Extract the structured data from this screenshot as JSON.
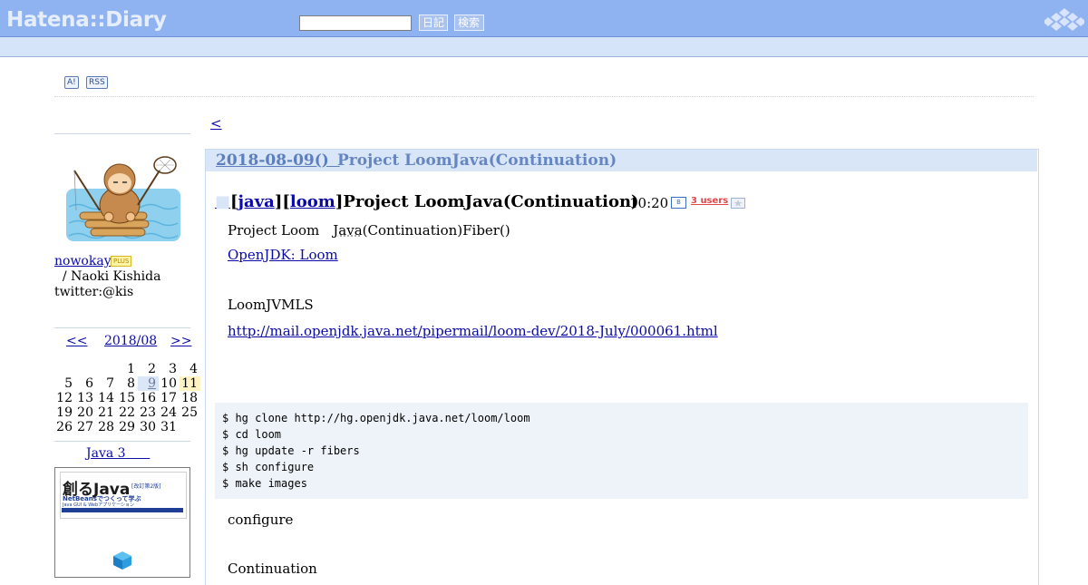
{
  "header": {
    "logo": "Hatena::Diary",
    "search": {
      "value": "",
      "placeholder": ""
    },
    "diary_button": "日記",
    "search_button": "検索"
  },
  "icons": {
    "a_badge": "A!",
    "rss_badge": "RSS"
  },
  "sidebar": {
    "user_link": "nowokay",
    "plus_badge": "PLUS",
    "user_name": "  / Naoki Kishida",
    "twitter": "twitter:@kis",
    "calendar": {
      "prev": "<<",
      "title": "2018/08",
      "next": ">>",
      "weeks": [
        [
          "",
          "",
          "",
          "1",
          "2",
          "3",
          "4"
        ],
        [
          "5",
          "6",
          "7",
          "8",
          "9",
          "10",
          "11"
        ],
        [
          "12",
          "13",
          "14",
          "15",
          "16",
          "17",
          "18"
        ],
        [
          "19",
          "20",
          "21",
          "22",
          "23",
          "24",
          "25"
        ],
        [
          "26",
          "27",
          "28",
          "29",
          "30",
          "31",
          ""
        ]
      ],
      "linked_day": "9",
      "highlighted_day": "11"
    },
    "book_link": "Java 3",
    "book": {
      "title": "創るJava",
      "tag": "[改訂第2版]",
      "subtitle": "NetBeansでつくって学ぶ",
      "subtitle2": "Java GUI & Webアプリケーション"
    }
  },
  "main": {
    "back_link": "<",
    "day_date": "2018-08-09()",
    "day_title": "Project LoomJava(Continuation)",
    "section": {
      "tag_java": "java",
      "tag_loom": "loom",
      "title": "Project LoomJava(Continuation)",
      "time": "10:20",
      "bookmark_icon": "B",
      "users": "3 users"
    },
    "para1_a": "Project Loom　",
    "para1_java": "Java",
    "para1_b": "(Continuation)Fiber()",
    "link_openjdk": "OpenJDK: Loom",
    "para_loom": "LoomJVMLS",
    "link_mail": "http://mail.openjdk.java.net/pipermail/loom-dev/2018-July/000061.html",
    "code_lines": [
      "$ hg clone http://hg.openjdk.java.net/loom/loom",
      "$ cd loom",
      "$ hg update -r fibers",
      "$ sh configure",
      "$ make images"
    ],
    "para_configure": "configure",
    "para_continuation": "Continuation"
  }
}
